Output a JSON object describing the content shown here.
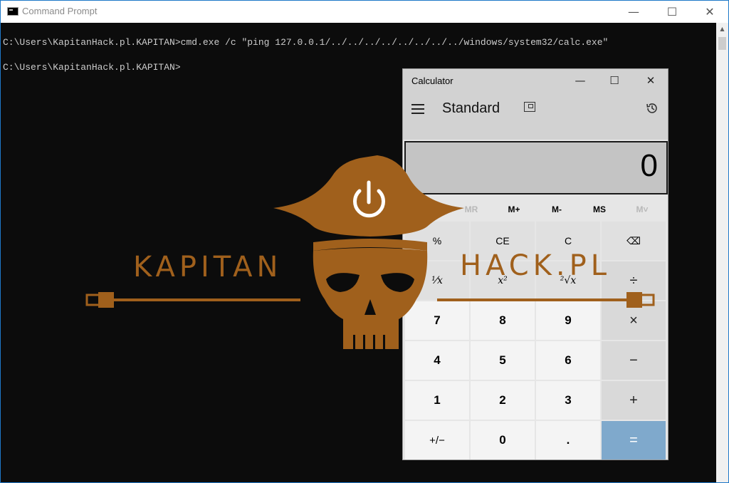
{
  "cmd": {
    "title": "Command Prompt",
    "window_buttons": {
      "minimize": "—",
      "maximize": "☐",
      "close": "✕"
    },
    "lines": [
      "C:\\Users\\KapitanHack.pl.KAPITAN>cmd.exe /c \"ping 127.0.0.1/../../../../../../../../windows/system32/calc.exe\"",
      "C:\\Users\\KapitanHack.pl.KAPITAN>"
    ],
    "scroll_up_icon": "▲"
  },
  "calculator": {
    "title": "Calculator",
    "window_buttons": {
      "minimize": "—",
      "maximize": "☐",
      "close": "✕"
    },
    "mode": "Standard",
    "display": "0",
    "memory": [
      {
        "label": "MC",
        "enabled": false
      },
      {
        "label": "MR",
        "enabled": false
      },
      {
        "label": "M+",
        "enabled": true
      },
      {
        "label": "M-",
        "enabled": true
      },
      {
        "label": "MS",
        "enabled": true
      },
      {
        "label": "M˅",
        "enabled": false
      }
    ],
    "keys": [
      [
        "%",
        "CE",
        "C",
        "⌫"
      ],
      [
        "¹⁄x",
        "x²",
        "²√x",
        "÷"
      ],
      [
        "7",
        "8",
        "9",
        "×"
      ],
      [
        "4",
        "5",
        "6",
        "−"
      ],
      [
        "1",
        "2",
        "3",
        "+"
      ],
      [
        "+/−",
        "0",
        ".",
        "="
      ]
    ],
    "colors": {
      "equals": "#7fa9cc",
      "display_bg": "#c4c4c4"
    }
  },
  "watermark": {
    "left_word": "KAPITAN",
    "right_word": "HACK.PL",
    "color": "#a0601c",
    "icon": "pirate-skull-power-logo"
  }
}
